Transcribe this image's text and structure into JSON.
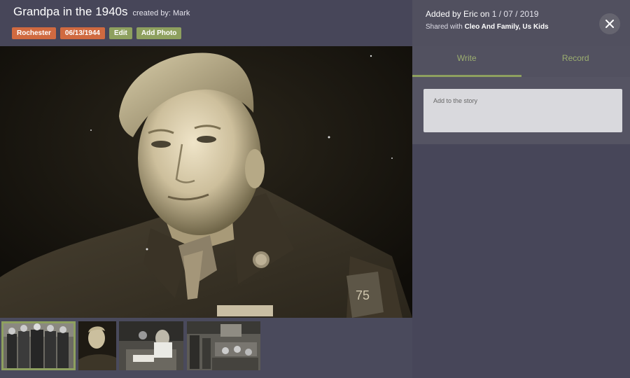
{
  "album": {
    "title": "Grandpa in the 1940s",
    "creator": "created by: Mark"
  },
  "tags": [
    {
      "label": "Rochester",
      "color": "#d06a40"
    },
    {
      "label": "06/13/1944",
      "color": "#d06a40"
    }
  ],
  "actions": {
    "edit_label": "Edit",
    "add_photo_label": "Add Photo"
  },
  "info": {
    "added_prefix": "Added by Eric on",
    "added_date": "1 / 07 / 2019",
    "shared_prefix": "Shared with",
    "shared_with": "Cleo And Family, Us Kids"
  },
  "tabs": [
    {
      "label": "Write",
      "active": true
    },
    {
      "label": "Record",
      "active": false
    }
  ],
  "story": {
    "placeholder": "Add to the story"
  },
  "thumbnails": [
    {
      "name": "family-group",
      "active": true
    },
    {
      "name": "soldier-portrait",
      "active": false
    },
    {
      "name": "workbench",
      "active": false
    },
    {
      "name": "room-gathering",
      "active": false
    }
  ],
  "colors": {
    "accent_green": "#8ea05f",
    "tag_orange": "#d06a40",
    "background": "#474659"
  },
  "icons": {
    "close": "close-icon"
  }
}
